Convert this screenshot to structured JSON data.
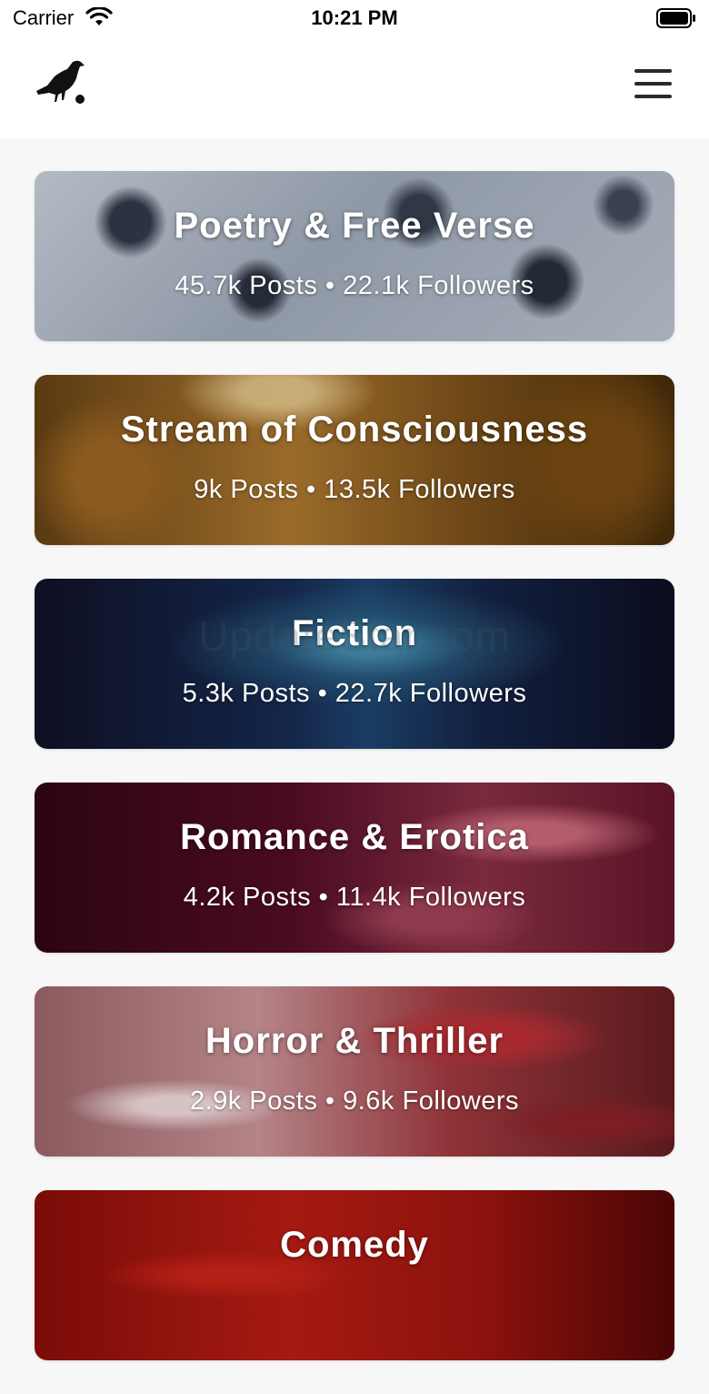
{
  "status_bar": {
    "carrier": "Carrier",
    "time": "10:21 PM"
  },
  "nav": {
    "logo_icon": "crow-logo-icon",
    "menu_icon": "hamburger-menu-icon"
  },
  "categories": [
    {
      "title": "Poetry & Free Verse",
      "stats": "45.7k Posts • 22.1k Followers"
    },
    {
      "title": "Stream of Consciousness",
      "stats": "9k Posts • 13.5k Followers"
    },
    {
      "title": "Fiction",
      "stats": "5.3k Posts • 22.7k Followers"
    },
    {
      "title": "Romance & Erotica",
      "stats": "4.2k Posts • 11.4k Followers"
    },
    {
      "title": "Horror & Thriller",
      "stats": "2.9k Posts • 9.6k Followers"
    },
    {
      "title": "Comedy",
      "stats": ""
    }
  ],
  "watermark": "UpdateStar.com"
}
